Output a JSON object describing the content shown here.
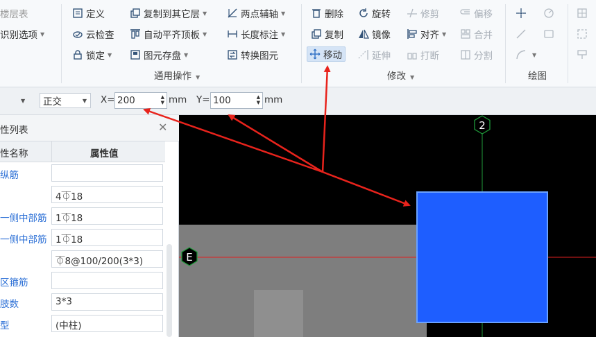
{
  "ribbon": {
    "partial_left": {
      "layer_label": "楼层表",
      "identify_label": "识别选项"
    },
    "group1": {
      "define": "定义",
      "cloud_check": "云检查",
      "lock": "锁定",
      "copy_to_layer": "复制到其它层",
      "auto_align": "自动平齐顶板",
      "element_storage": "图元存盘",
      "two_point_axis": "两点辅轴",
      "length_dim": "长度标注",
      "convert_element": "转换图元",
      "label": "通用操作"
    },
    "group2": {
      "delete": "删除",
      "rotate": "旋转",
      "trim": "修剪",
      "offset": "偏移",
      "copy": "复制",
      "mirror": "镜像",
      "align": "对齐",
      "merge": "合并",
      "move": "移动",
      "extend": "延伸",
      "break": "打断",
      "split": "分割",
      "label": "修改"
    },
    "group3": {
      "label": "绘图"
    }
  },
  "coordbar": {
    "mode": "正交",
    "x_label": "X=",
    "x_value": "200",
    "y_label": "Y=",
    "y_value": "100",
    "unit": "mm"
  },
  "panel": {
    "title": "性列表",
    "col_name": "性名称",
    "col_value": "属性值",
    "rows": [
      {
        "name": "纵筋",
        "value": ""
      },
      {
        "name": "",
        "value": "4⏁18"
      },
      {
        "name": "一侧中部筋",
        "value": "1⏁18"
      },
      {
        "name": "一侧中部筋",
        "value": "1⏁18"
      },
      {
        "name": "",
        "value": "⏁8@100/200(3*3)"
      },
      {
        "name": "区箍筋",
        "value": ""
      },
      {
        "name": "肢数",
        "value": "3*3"
      },
      {
        "name": "型",
        "value": "(中柱)"
      }
    ]
  },
  "canvas": {
    "axis_2": "2",
    "axis_e": "E",
    "colors": {
      "column": "#1e5eff",
      "axis_v": "#1f9a3a",
      "axis_h": "#e02020",
      "arrow": "#e8231c"
    }
  }
}
